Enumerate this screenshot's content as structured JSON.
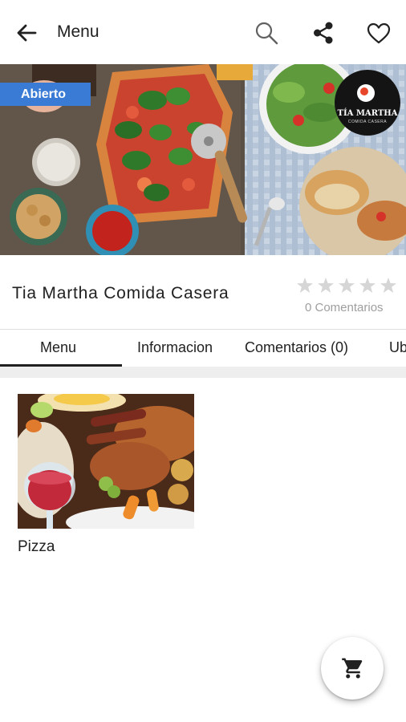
{
  "appbar": {
    "title": "Menu",
    "icons": [
      "back-arrow-icon",
      "search-icon",
      "share-icon",
      "heart-icon"
    ]
  },
  "restaurant": {
    "status_badge": "Abierto",
    "logo_text": "TÍA MARTHA",
    "logo_subtext": "COMIDA CASERA",
    "name": "Tia Martha Comida Casera",
    "rating": 0,
    "rating_max": 5,
    "comments": "0 Comentarios"
  },
  "tabs": [
    {
      "label": "Menu",
      "active": true
    },
    {
      "label": "Informacion",
      "active": false
    },
    {
      "label": "Comentarios (0)",
      "active": false
    },
    {
      "label": "Ub",
      "active": false
    }
  ],
  "menu_items": [
    {
      "label": "Pizza"
    }
  ],
  "fab": {
    "icon": "cart-icon"
  },
  "colors": {
    "badge": "#3a7bd5",
    "logo_bg": "#141414",
    "star_empty": "#d6d6d6",
    "separator": "#eeeeee"
  }
}
